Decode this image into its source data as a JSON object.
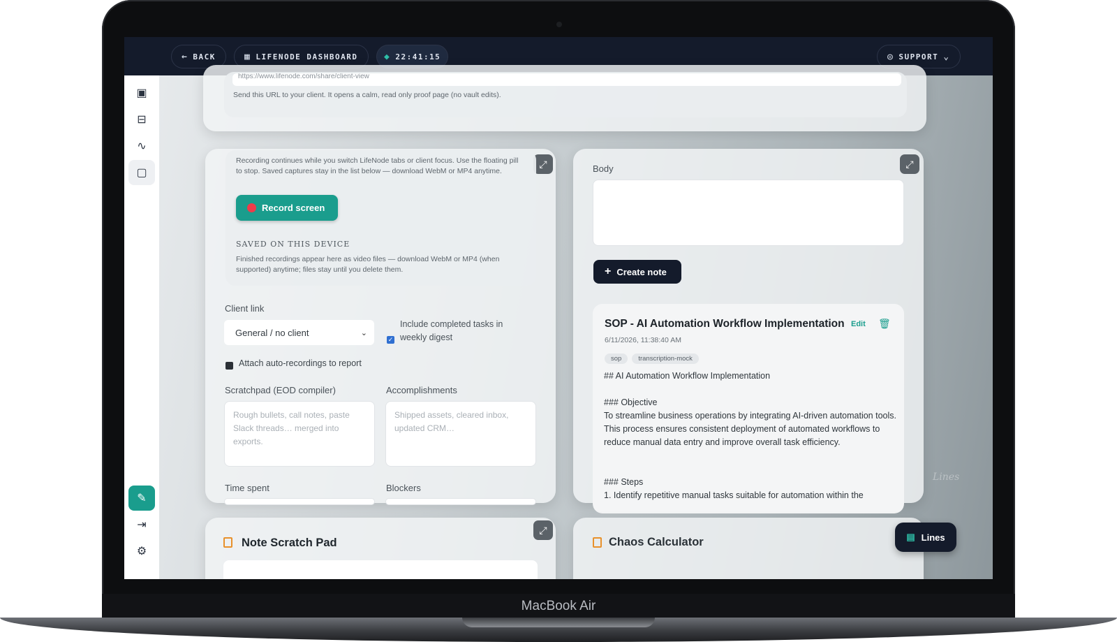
{
  "topbar": {
    "back_label": "BACK",
    "dashboard_label": "LIFENODE DASHBOARD",
    "timer": "22:41:15",
    "support_label": "SUPPORT"
  },
  "share": {
    "url": "https://www.lifenode.com/share/client-view",
    "hint": "Send this URL to your client. It opens a calm, read only proof page (no vault edits)."
  },
  "recorder": {
    "description": "Recording continues while you switch LifeNode tabs or client focus. Use the floating pill to stop. Saved captures stay in the list below — download WebM or MP4 anytime.",
    "record_label": "Record screen",
    "saved_heading": "SAVED ON THIS DEVICE",
    "saved_text": "Finished recordings appear here as video files — download WebM or MP4 (when supported) anytime; files stay until you delete them."
  },
  "report": {
    "client_link_label": "Client link",
    "client_select_value": "General / no client",
    "include_tasks_label": "Include completed tasks in weekly digest",
    "include_tasks_checked": true,
    "attach_label": "Attach auto-recordings to report",
    "attach_checked": false,
    "scratchpad_label": "Scratchpad (EOD compiler)",
    "scratchpad_placeholder": "Rough bullets, call notes, paste Slack threads… merged into exports.",
    "accomplishments_label": "Accomplishments",
    "accomplishments_placeholder": "Shipped assets, cleared inbox, updated CRM…",
    "time_spent_label": "Time spent",
    "blockers_label": "Blockers"
  },
  "notes": {
    "body_label": "Body",
    "create_label": "Create note",
    "note": {
      "title": "SOP - AI Automation Workflow Implementation",
      "edit_label": "Edit",
      "timestamp": "6/11/2026, 11:38:40 AM",
      "tags": [
        "sop",
        "transcription-mock"
      ],
      "h2": "## AI Automation Workflow Implementation",
      "h3_objective": "### Objective",
      "objective": "To streamline business operations by integrating AI-driven automation tools. This process ensures consistent deployment of automated workflows to reduce manual data entry and improve overall task efficiency.",
      "h3_steps": "### Steps",
      "step1": "1. Identify repetitive manual tasks suitable for automation within the"
    }
  },
  "widgets": {
    "scratch_title": "Note Scratch Pad",
    "chaos_title": "Chaos Calculator",
    "lines_label": "Lines",
    "watermark": "Lines"
  },
  "device": {
    "model": "MacBook Air"
  },
  "colors": {
    "accent_teal": "#1a9d8d",
    "navy": "#141b2b",
    "record_red": "#ef3b4a",
    "orange": "#e8912c"
  }
}
